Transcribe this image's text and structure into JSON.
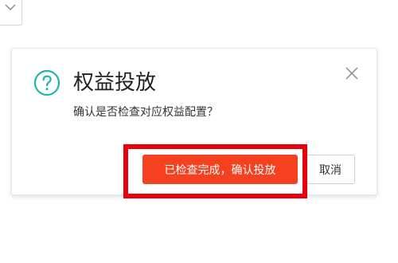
{
  "background_select": {
    "icon": "chevron-down-icon"
  },
  "dialog": {
    "icon": "question-circle-icon",
    "title": "权益投放",
    "message": "确认是否检查对应权益配置？",
    "close_icon": "close-icon",
    "confirm_label": "已检查完成，确认投放",
    "cancel_label": "取消"
  },
  "colors": {
    "accent_teal": "#1fb5ad",
    "primary_button": "#f5411f",
    "highlight_border": "#e8000b"
  }
}
